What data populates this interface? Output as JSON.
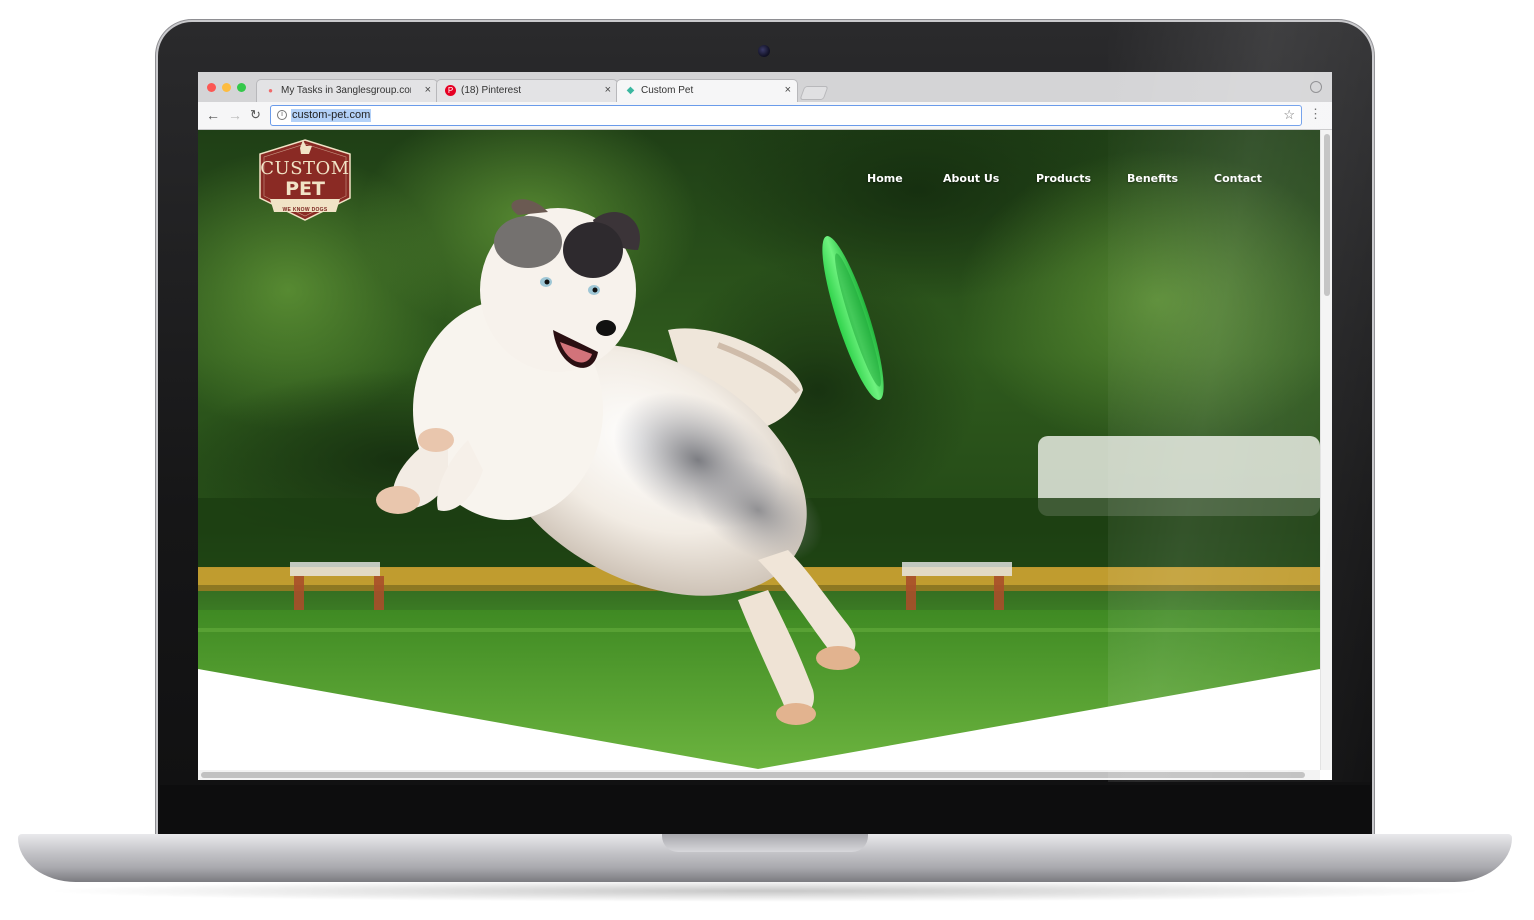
{
  "browser": {
    "tabs": [
      {
        "title": "My Tasks in 3anglesgroup.com",
        "icon": "asana-icon",
        "active": false
      },
      {
        "title": "(18) Pinterest",
        "icon": "pinterest-icon",
        "active": false
      },
      {
        "title": "Custom Pet",
        "icon": "diamond-favicon-icon",
        "active": true
      }
    ],
    "close_glyph": "×",
    "url": "custom-pet.com",
    "back_glyph": "←",
    "forward_glyph": "→",
    "reload_glyph": "↻",
    "star_glyph": "☆",
    "menu_glyph": "⋮",
    "info_glyph": "i"
  },
  "site": {
    "logo": {
      "line1": "CUSTOM",
      "line2": "PET",
      "tagline": "WE KNOW DOGS"
    },
    "nav": [
      "Home",
      "About Us",
      "Products",
      "Benefits",
      "Contact"
    ]
  },
  "colors": {
    "logo_red": "#8a2a24",
    "frisbee_green": "#3fe05a",
    "grass": "#4f9a2c",
    "fence": "#d9a632"
  }
}
